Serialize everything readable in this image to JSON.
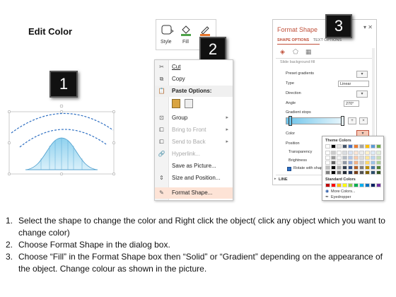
{
  "title": "Edit Color",
  "badges": {
    "b1": "1",
    "b2": "2",
    "b3": "3"
  },
  "toolbar": {
    "style_label": "Style",
    "fill_label": "Fill",
    "outline_label": "O"
  },
  "context_menu": {
    "items": [
      {
        "label": "Cut",
        "icon": "scissors-icon",
        "state": "normal",
        "submenu": false
      },
      {
        "label": "Copy",
        "icon": "copy-icon",
        "state": "normal",
        "submenu": false
      },
      {
        "label": "Paste Options:",
        "icon": "paste-icon",
        "state": "header",
        "submenu": false
      },
      {
        "label": "",
        "icon": "paste-options-icons",
        "state": "normal",
        "submenu": false
      },
      {
        "label": "Group",
        "icon": "group-icon",
        "state": "normal",
        "submenu": true
      },
      {
        "label": "Bring to Front",
        "icon": "bring-front-icon",
        "state": "disabled",
        "submenu": true
      },
      {
        "label": "Send to Back",
        "icon": "send-back-icon",
        "state": "disabled",
        "submenu": true
      },
      {
        "label": "Hyperlink...",
        "icon": "hyperlink-icon",
        "state": "disabled",
        "submenu": false
      },
      {
        "label": "Save as Picture...",
        "icon": "",
        "state": "normal",
        "submenu": false
      },
      {
        "label": "Size and Position...",
        "icon": "size-icon",
        "state": "normal",
        "submenu": false
      },
      {
        "label": "Format Shape...",
        "icon": "format-shape-icon",
        "state": "highlighted",
        "submenu": false
      }
    ]
  },
  "format_pane": {
    "title": "Format Shape",
    "tab_shape": "SHAPE OPTIONS",
    "tab_text": "TEXT OPTIONS",
    "slide_bg": "Slide background fill",
    "rows": {
      "preset": "Preset gradients",
      "type": "Type",
      "type_value": "Linear",
      "direction": "Direction",
      "angle": "Angle",
      "angle_value": "270°",
      "stops": "Gradient stops",
      "color": "Color",
      "position": "Position",
      "transparency": "Transparency",
      "brightness": "Brightness",
      "rotate": "Rotate with shap"
    },
    "line_section": "LINE"
  },
  "palette": {
    "theme_label": "Theme Colors",
    "standard_label": "Standard Colors",
    "more_colors": "More Colors...",
    "eyedropper": "Eyedropper",
    "theme_top": [
      "#ffffff",
      "#000000",
      "#e7e6e6",
      "#44546a",
      "#4472c4",
      "#ed7d31",
      "#a5a5a5",
      "#ffc000",
      "#5b9bd5",
      "#70ad47"
    ],
    "standard": [
      "#c00000",
      "#ff0000",
      "#ffc000",
      "#ffff00",
      "#92d050",
      "#00b050",
      "#00b0f0",
      "#0070c0",
      "#002060",
      "#7030a0"
    ]
  },
  "instructions": [
    {
      "num": "1.",
      "text": "Select the shape to change the color and Right click the object( click any object which you want to change color)"
    },
    {
      "num": "2.",
      "text": "Choose Format Shape in the dialog box."
    },
    {
      "num": "3.",
      "text": "Choose “Fill” in the Format Shape box then “Solid” or “Gradient” depending on the appearance of the object. Change colour as shown in the picture."
    }
  ]
}
